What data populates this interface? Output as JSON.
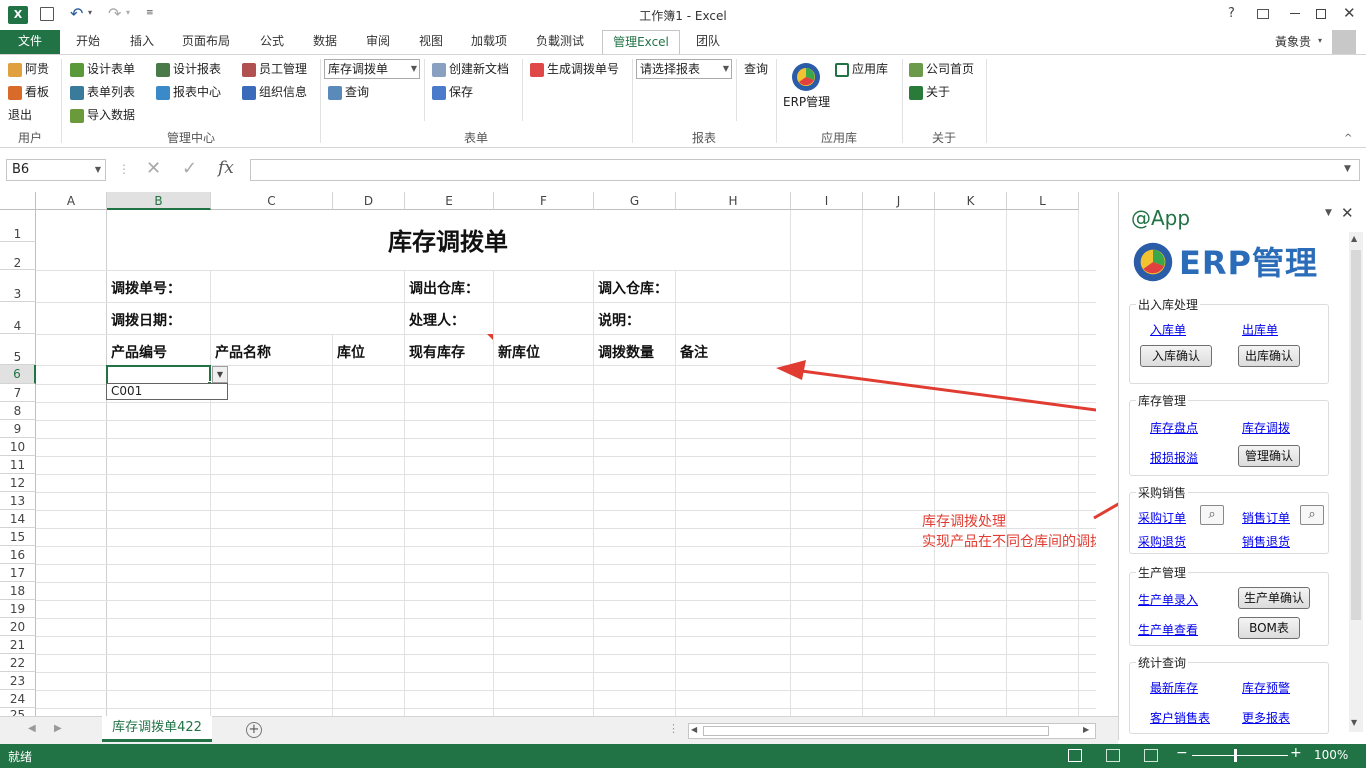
{
  "window": {
    "title": "工作簿1 - Excel",
    "user": "黃象贵"
  },
  "tabs": [
    "文件",
    "开始",
    "插入",
    "页面布局",
    "公式",
    "数据",
    "审阅",
    "视图",
    "加载项",
    "负載测试",
    "管理Excel",
    "团队"
  ],
  "ribbon": {
    "user_group": {
      "items": [
        "阿贵",
        "看板",
        "退出"
      ],
      "label": "用户"
    },
    "mgmt_group": {
      "items": [
        "设计表单",
        "表单列表",
        "导入数据",
        "设计报表",
        "报表中心",
        "员工管理",
        "组织信息"
      ],
      "label": "管理中心"
    },
    "form_group": {
      "combo": "库存调拨单",
      "items": [
        "查询",
        "创建新文档",
        "保存",
        "生成调拨单号"
      ],
      "label": "表单"
    },
    "report_group": {
      "combo": "请选择报表",
      "query": "查询",
      "label": "报表"
    },
    "app_group": {
      "erp": "ERP管理",
      "applib": "应用库",
      "label": "应用库"
    },
    "about_group": {
      "home": "公司首页",
      "about": "关于",
      "label": "关于"
    }
  },
  "formula_bar": {
    "name_box": "B6",
    "formula": ""
  },
  "columns": [
    "A",
    "B",
    "C",
    "D",
    "E",
    "F",
    "G",
    "H",
    "I",
    "J",
    "K",
    "L"
  ],
  "rows": [
    "1",
    "2",
    "3",
    "4",
    "5",
    "6",
    "7",
    "8",
    "9",
    "10",
    "11",
    "12",
    "13",
    "14",
    "15",
    "16",
    "17",
    "18",
    "19",
    "20",
    "21",
    "22",
    "23",
    "24",
    "25"
  ],
  "sheet": {
    "title": "库存调拨单",
    "labels": {
      "transfer_no": "调拨单号：",
      "out_wh": "调出仓库：",
      "in_wh": "调入仓库：",
      "transfer_date": "调拨日期：",
      "handler": "处理人：",
      "note": "说明："
    },
    "headers": [
      "产品编号",
      "产品名称",
      "库位",
      "现有库存",
      "新库位",
      "调拨数量",
      "备注"
    ],
    "dropdown_option": "C001"
  },
  "annotation": {
    "line1": "库存调拨处理",
    "line2": "实现产品在不同仓库间的调拨"
  },
  "taskpane": {
    "title": "@App",
    "logo_text": "ERP管理",
    "sections": {
      "inout": {
        "title": "出入库处理",
        "links": [
          "入库单",
          "出库单"
        ],
        "buttons": [
          "入库确认",
          "出库确认"
        ]
      },
      "stock": {
        "title": "库存管理",
        "links": [
          "库存盘点",
          "库存调拨",
          "报损报溢"
        ],
        "buttons": [
          "管理确认"
        ]
      },
      "sales": {
        "title": "采购销售",
        "links": [
          "采购订单",
          "销售订单",
          "采购退货",
          "销售退货"
        ]
      },
      "prod": {
        "title": "生产管理",
        "links": [
          "生产单录入",
          "生产单查看"
        ],
        "buttons": [
          "生产单确认",
          "BOM表"
        ]
      },
      "stats": {
        "title": "统计查询",
        "links": [
          "最新库存",
          "库存预警",
          "客户销售表",
          "更多报表"
        ]
      }
    }
  },
  "sheet_tab": "库存调拨单422",
  "status": {
    "ready": "就绪",
    "zoom": "100%"
  },
  "colors": {
    "excel_green": "#217346",
    "arrow_red": "#e03c31",
    "link_blue": "#0000ee"
  }
}
